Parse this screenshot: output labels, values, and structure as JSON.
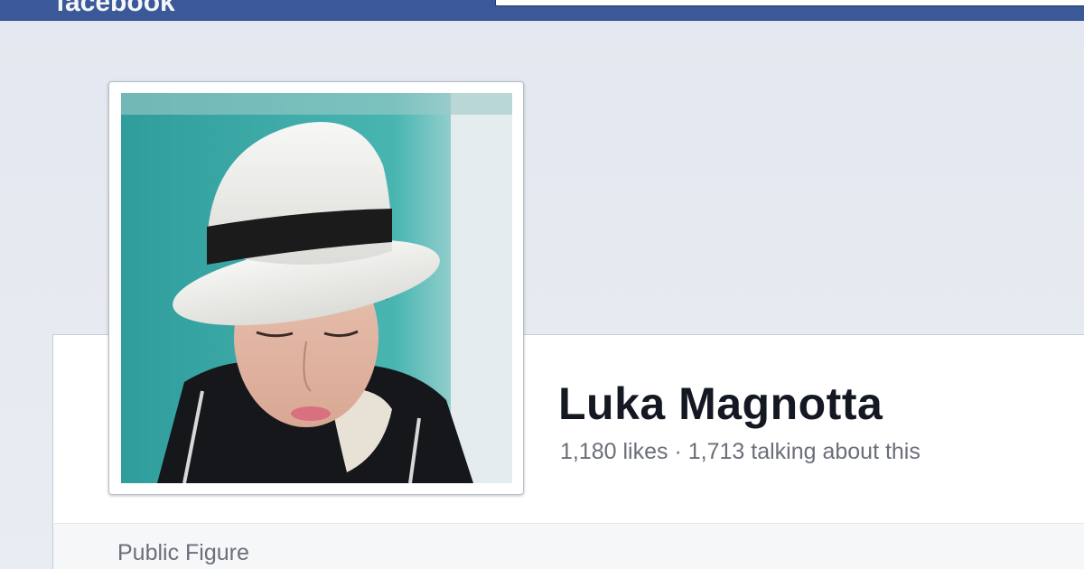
{
  "header": {
    "logo_text": "facebook",
    "brand_color": "#3b5998"
  },
  "profile": {
    "name": "Luka Magnotta",
    "likes_text": "1,180 likes · 1,713 talking about this",
    "category": "Public Figure",
    "photo_icon": "profile-photo"
  },
  "colors": {
    "background": "#e9ecf2",
    "name_text": "#141823",
    "secondary_text": "#6a6f79"
  }
}
